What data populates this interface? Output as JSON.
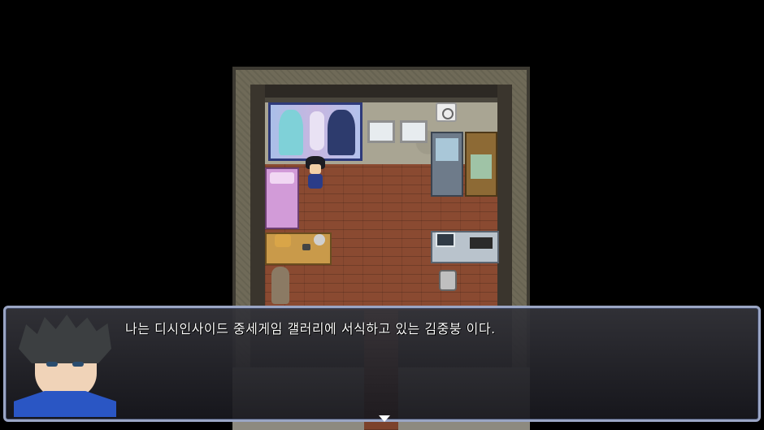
{
  "game": {
    "scene": "bedroom-map"
  },
  "message": {
    "text": "나는 디시인사이드 중세게임 갤러리에 서식하고 있는 김중붕 이다.",
    "face_icon": "hero-portrait",
    "continue_icon": "down-triangle-icon"
  },
  "colors": {
    "floor": "#8a4a31",
    "window_border": "#9aa5c4",
    "text": "#ffffff"
  }
}
